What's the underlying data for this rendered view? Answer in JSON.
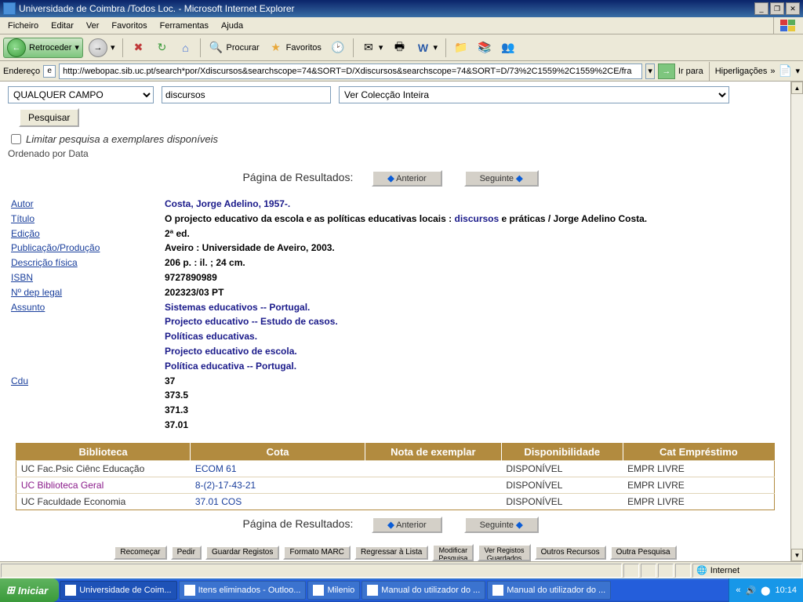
{
  "window": {
    "title": "Universidade de Coimbra /Todos Loc. - Microsoft Internet Explorer"
  },
  "menubar": {
    "items": [
      "Ficheiro",
      "Editar",
      "Ver",
      "Favoritos",
      "Ferramentas",
      "Ajuda"
    ]
  },
  "toolbar": {
    "back": "Retroceder",
    "search": "Procurar",
    "favorites": "Favoritos"
  },
  "addressbar": {
    "label": "Endereço",
    "url": "http://webopac.sib.uc.pt/search*por/Xdiscursos&searchscope=74&SORT=D/Xdiscursos&searchscope=74&SORT=D/73%2C1559%2C1559%2CE/fra",
    "go": "Ir para",
    "links": "Hiperligações"
  },
  "search": {
    "field_select": "QUALQUER CAMPO",
    "query": "discursos",
    "collection": "Ver Colecção Inteira",
    "button": "Pesquisar",
    "limit_label": "Limitar pesquisa a exemplares disponíveis",
    "ordered": "Ordenado por Data"
  },
  "pager": {
    "label": "Página de Resultados:",
    "prev": "Anterior",
    "next": "Seguinte"
  },
  "record": {
    "labels": {
      "autor": "Autor",
      "titulo": "Título",
      "edicao": "Edição",
      "publicacao": "Publicação/Produção",
      "descricao": "Descrição física",
      "isbn": "ISBN",
      "deplegal": "Nº dep legal",
      "assunto": "Assunto",
      "cdu": "Cdu"
    },
    "autor": "Costa, Jorge Adelino, 1957-.",
    "titulo_a": "O projecto educativo da escola e as políticas educativas locais : ",
    "titulo_link": "discursos",
    "titulo_b": " e práticas / Jorge Adelino Costa.",
    "edicao": "2ª ed.",
    "publicacao": "Aveiro : Universidade de Aveiro, 2003.",
    "descricao": "206 p. : il. ; 24 cm.",
    "isbn": "9727890989",
    "deplegal": "202323/03 PT",
    "assuntos": [
      "Sistemas educativos -- Portugal.",
      "Projecto educativo -- Estudo de casos.",
      "Políticas educativas.",
      "Projecto educativo de escola.",
      "Política educativa -- Portugal."
    ],
    "cdu": [
      "37",
      "373.5",
      "371.3",
      "37.01"
    ]
  },
  "holdings": {
    "headers": {
      "biblioteca": "Biblioteca",
      "cota": "Cota",
      "nota": "Nota de exemplar",
      "dispon": "Disponibilidade",
      "cat": "Cat Empréstimo"
    },
    "rows": [
      {
        "bib": "UC Fac.Psic Ciênc Educação",
        "cota": "ECOM 61",
        "nota": "",
        "disp": "DISPONÍVEL",
        "cat": "EMPR LIVRE",
        "visited": false
      },
      {
        "bib": "UC Biblioteca Geral",
        "cota": "8-(2)-17-43-21",
        "nota": "",
        "disp": "DISPONÍVEL",
        "cat": "EMPR LIVRE",
        "visited": true
      },
      {
        "bib": "UC Faculdade Economia",
        "cota": "37.01 COS",
        "nota": "",
        "disp": "DISPONÍVEL",
        "cat": "EMPR LIVRE",
        "visited": false
      }
    ]
  },
  "actions": [
    "Recomeçar",
    "Pedir",
    "Guardar Registos",
    "Formato MARC",
    "Regressar à Lista",
    "Modificar\nPesquisa",
    "Ver Registos\nGuardados",
    "Outros Recursos",
    "Outra Pesquisa"
  ],
  "statusbar": {
    "zone": "Internet"
  },
  "taskbar": {
    "start": "Iniciar",
    "tasks": [
      "Universidade de Coim...",
      "Itens eliminados - Outloo...",
      "Milenio",
      "Manual do utilizador do ...",
      "Manual do utilizador do ..."
    ],
    "clock": "10:14"
  }
}
